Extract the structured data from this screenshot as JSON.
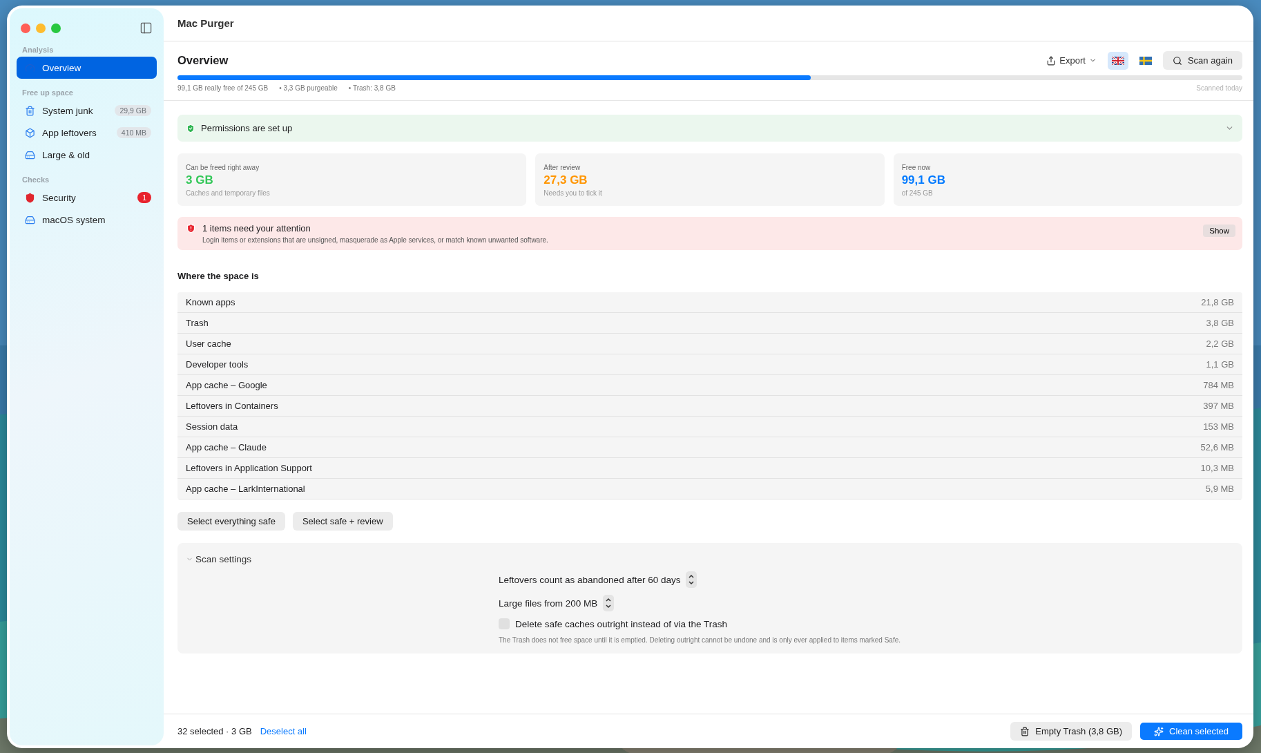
{
  "window": {
    "title": "Mac Purger"
  },
  "sidebar": {
    "sections": [
      {
        "heading": "Analysis",
        "items": [
          {
            "label": "Overview",
            "selected": true
          }
        ]
      },
      {
        "heading": "Free up space",
        "items": [
          {
            "label": "System junk",
            "selected": false,
            "badge": {
              "kind": "size",
              "text": "29,9 GB"
            }
          },
          {
            "label": "App leftovers",
            "selected": false,
            "badge": {
              "kind": "size",
              "text": "410 MB"
            }
          },
          {
            "label": "Large & old",
            "selected": false
          }
        ]
      },
      {
        "heading": "Checks",
        "items": [
          {
            "label": "Security",
            "selected": false,
            "badge": {
              "kind": "alert",
              "text": "1"
            }
          },
          {
            "label": "macOS system",
            "selected": false
          }
        ]
      }
    ]
  },
  "header": {
    "title": "Overview",
    "export": "Export",
    "languages": [
      {
        "kind": "uk",
        "selected": true
      },
      {
        "kind": "sweden",
        "selected": false
      }
    ],
    "scan_button": "Scan again",
    "usage": {
      "level": 0.595,
      "stats": [
        "99,1 GB really free of 245 GB",
        "• 3,3 GB purgeable",
        "• Trash: 3,8 GB"
      ],
      "scanned": "Scanned today"
    }
  },
  "permissions": {
    "text": "Permissions are set up",
    "expanded": false
  },
  "cards": [
    {
      "label": "Can be freed right away",
      "value": "3 GB",
      "note": "Caches and temporary files",
      "color": "#34c759"
    },
    {
      "label": "After review",
      "value": "27,3 GB",
      "note": "Needs you to tick it",
      "color": "#ff9500"
    },
    {
      "label": "Free now",
      "value": "99,1 GB",
      "note": "of 245 GB",
      "color": "#007aff"
    }
  ],
  "attention": {
    "title": "1 items need your attention",
    "text": "Login items or extensions that are unsigned, masquerade as Apple services, or match known unwanted software.",
    "button": "Show"
  },
  "space": {
    "heading": "Where the space is",
    "rows": [
      {
        "name": "Known apps",
        "size": "21,8 GB"
      },
      {
        "name": "Trash",
        "size": "3,8 GB"
      },
      {
        "name": "User cache",
        "size": "2,2 GB"
      },
      {
        "name": "Developer tools",
        "size": "1,1 GB"
      },
      {
        "name": "App cache – Google",
        "size": "784 MB"
      },
      {
        "name": "Leftovers in Containers",
        "size": "397 MB"
      },
      {
        "name": "Session data",
        "size": "153 MB"
      },
      {
        "name": "App cache – Claude",
        "size": "52,6 MB"
      },
      {
        "name": "Leftovers in Application Support",
        "size": "10,3 MB"
      },
      {
        "name": "App cache – LarkInternational",
        "size": "5,9 MB"
      }
    ]
  },
  "select_buttons": [
    "Select everything safe",
    "Select safe + review"
  ],
  "scan_settings": {
    "title": "Scan settings",
    "expanded": true,
    "steppers": [
      "Leftovers count as abandoned after 60 days",
      "Large files from 200 MB"
    ],
    "checkbox": {
      "label": "Delete safe caches outright instead of via the Trash",
      "checked": false
    },
    "note": "The Trash does not free space until it is emptied. Deleting outright cannot be undone and is only ever applied to items marked Safe."
  },
  "footer": {
    "summary": "32 selected · 3 GB",
    "deselect": "Deselect all",
    "empty_trash": "Empty Trash (3,8 GB)",
    "clean": "Clean selected"
  }
}
